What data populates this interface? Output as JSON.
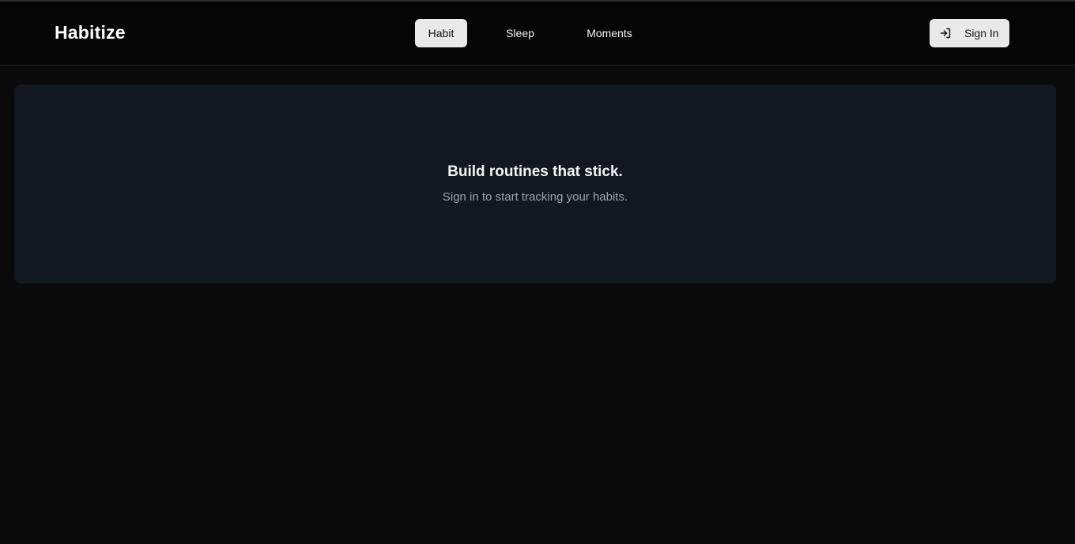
{
  "app": {
    "brand": "Habitize"
  },
  "nav": {
    "items": [
      {
        "label": "Habit",
        "active": true
      },
      {
        "label": "Sleep",
        "active": false
      },
      {
        "label": "Moments",
        "active": false
      }
    ]
  },
  "auth": {
    "sign_in_label": "Sign In",
    "icon": "sign-in-icon"
  },
  "hero": {
    "title": "Build routines that stick.",
    "subtitle": "Sign in to start tracking your habits."
  },
  "colors": {
    "background": "#0a0a0a",
    "header": "#050505",
    "card": "#111821",
    "active_pill": "#e9e9ea",
    "muted_text": "#9ca3af"
  }
}
